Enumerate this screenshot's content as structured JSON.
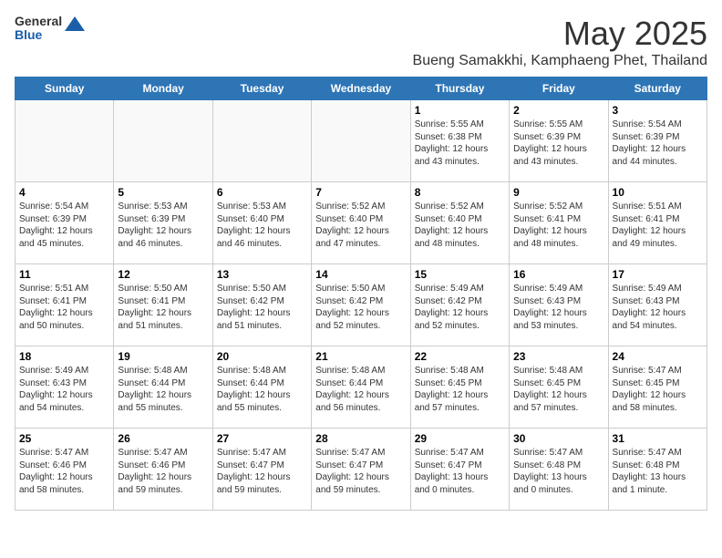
{
  "logo": {
    "general": "General",
    "blue": "Blue"
  },
  "title": {
    "month_year": "May 2025",
    "location": "Bueng Samakkhi, Kamphaeng Phet, Thailand"
  },
  "weekdays": [
    "Sunday",
    "Monday",
    "Tuesday",
    "Wednesday",
    "Thursday",
    "Friday",
    "Saturday"
  ],
  "weeks": [
    [
      {
        "day": "",
        "info": ""
      },
      {
        "day": "",
        "info": ""
      },
      {
        "day": "",
        "info": ""
      },
      {
        "day": "",
        "info": ""
      },
      {
        "day": "1",
        "info": "Sunrise: 5:55 AM\nSunset: 6:38 PM\nDaylight: 12 hours\nand 43 minutes."
      },
      {
        "day": "2",
        "info": "Sunrise: 5:55 AM\nSunset: 6:39 PM\nDaylight: 12 hours\nand 43 minutes."
      },
      {
        "day": "3",
        "info": "Sunrise: 5:54 AM\nSunset: 6:39 PM\nDaylight: 12 hours\nand 44 minutes."
      }
    ],
    [
      {
        "day": "4",
        "info": "Sunrise: 5:54 AM\nSunset: 6:39 PM\nDaylight: 12 hours\nand 45 minutes."
      },
      {
        "day": "5",
        "info": "Sunrise: 5:53 AM\nSunset: 6:39 PM\nDaylight: 12 hours\nand 46 minutes."
      },
      {
        "day": "6",
        "info": "Sunrise: 5:53 AM\nSunset: 6:40 PM\nDaylight: 12 hours\nand 46 minutes."
      },
      {
        "day": "7",
        "info": "Sunrise: 5:52 AM\nSunset: 6:40 PM\nDaylight: 12 hours\nand 47 minutes."
      },
      {
        "day": "8",
        "info": "Sunrise: 5:52 AM\nSunset: 6:40 PM\nDaylight: 12 hours\nand 48 minutes."
      },
      {
        "day": "9",
        "info": "Sunrise: 5:52 AM\nSunset: 6:41 PM\nDaylight: 12 hours\nand 48 minutes."
      },
      {
        "day": "10",
        "info": "Sunrise: 5:51 AM\nSunset: 6:41 PM\nDaylight: 12 hours\nand 49 minutes."
      }
    ],
    [
      {
        "day": "11",
        "info": "Sunrise: 5:51 AM\nSunset: 6:41 PM\nDaylight: 12 hours\nand 50 minutes."
      },
      {
        "day": "12",
        "info": "Sunrise: 5:50 AM\nSunset: 6:41 PM\nDaylight: 12 hours\nand 51 minutes."
      },
      {
        "day": "13",
        "info": "Sunrise: 5:50 AM\nSunset: 6:42 PM\nDaylight: 12 hours\nand 51 minutes."
      },
      {
        "day": "14",
        "info": "Sunrise: 5:50 AM\nSunset: 6:42 PM\nDaylight: 12 hours\nand 52 minutes."
      },
      {
        "day": "15",
        "info": "Sunrise: 5:49 AM\nSunset: 6:42 PM\nDaylight: 12 hours\nand 52 minutes."
      },
      {
        "day": "16",
        "info": "Sunrise: 5:49 AM\nSunset: 6:43 PM\nDaylight: 12 hours\nand 53 minutes."
      },
      {
        "day": "17",
        "info": "Sunrise: 5:49 AM\nSunset: 6:43 PM\nDaylight: 12 hours\nand 54 minutes."
      }
    ],
    [
      {
        "day": "18",
        "info": "Sunrise: 5:49 AM\nSunset: 6:43 PM\nDaylight: 12 hours\nand 54 minutes."
      },
      {
        "day": "19",
        "info": "Sunrise: 5:48 AM\nSunset: 6:44 PM\nDaylight: 12 hours\nand 55 minutes."
      },
      {
        "day": "20",
        "info": "Sunrise: 5:48 AM\nSunset: 6:44 PM\nDaylight: 12 hours\nand 55 minutes."
      },
      {
        "day": "21",
        "info": "Sunrise: 5:48 AM\nSunset: 6:44 PM\nDaylight: 12 hours\nand 56 minutes."
      },
      {
        "day": "22",
        "info": "Sunrise: 5:48 AM\nSunset: 6:45 PM\nDaylight: 12 hours\nand 57 minutes."
      },
      {
        "day": "23",
        "info": "Sunrise: 5:48 AM\nSunset: 6:45 PM\nDaylight: 12 hours\nand 57 minutes."
      },
      {
        "day": "24",
        "info": "Sunrise: 5:47 AM\nSunset: 6:45 PM\nDaylight: 12 hours\nand 58 minutes."
      }
    ],
    [
      {
        "day": "25",
        "info": "Sunrise: 5:47 AM\nSunset: 6:46 PM\nDaylight: 12 hours\nand 58 minutes."
      },
      {
        "day": "26",
        "info": "Sunrise: 5:47 AM\nSunset: 6:46 PM\nDaylight: 12 hours\nand 59 minutes."
      },
      {
        "day": "27",
        "info": "Sunrise: 5:47 AM\nSunset: 6:47 PM\nDaylight: 12 hours\nand 59 minutes."
      },
      {
        "day": "28",
        "info": "Sunrise: 5:47 AM\nSunset: 6:47 PM\nDaylight: 12 hours\nand 59 minutes."
      },
      {
        "day": "29",
        "info": "Sunrise: 5:47 AM\nSunset: 6:47 PM\nDaylight: 13 hours\nand 0 minutes."
      },
      {
        "day": "30",
        "info": "Sunrise: 5:47 AM\nSunset: 6:48 PM\nDaylight: 13 hours\nand 0 minutes."
      },
      {
        "day": "31",
        "info": "Sunrise: 5:47 AM\nSunset: 6:48 PM\nDaylight: 13 hours\nand 1 minute."
      }
    ]
  ]
}
